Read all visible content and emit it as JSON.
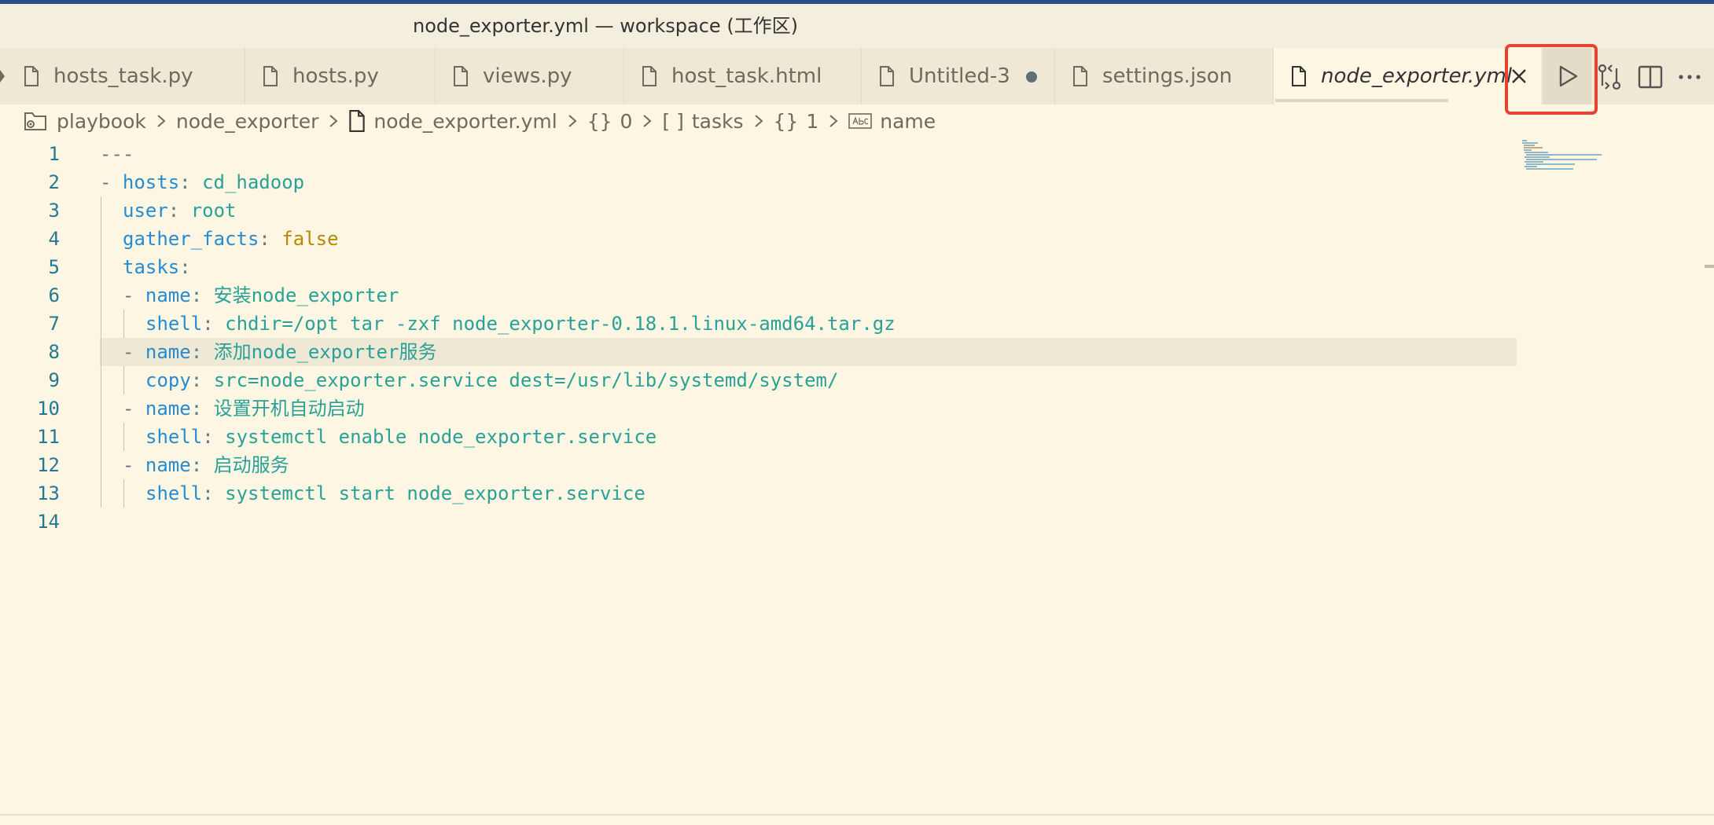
{
  "window": {
    "title": "node_exporter.yml — workspace (工作区)"
  },
  "tabs": [
    {
      "label": "hosts_task.py",
      "dirty": false,
      "active": false
    },
    {
      "label": "hosts.py",
      "dirty": false,
      "active": false
    },
    {
      "label": "views.py",
      "dirty": false,
      "active": false
    },
    {
      "label": "host_task.html",
      "dirty": false,
      "active": false
    },
    {
      "label": "Untitled-3",
      "dirty": true,
      "active": false
    },
    {
      "label": "settings.json",
      "dirty": false,
      "active": false
    },
    {
      "label": "node_exporter.yml",
      "dirty": false,
      "active": true
    }
  ],
  "editor_actions": [
    "run-icon",
    "open-changes-icon",
    "split-editor-icon",
    "more-actions-icon"
  ],
  "breadcrumb": {
    "items": [
      "playbook",
      "node_exporter",
      "node_exporter.yml",
      "0",
      "tasks",
      "1",
      "name"
    ],
    "glyphs": {
      "object": "{}",
      "array": "[ ]"
    }
  },
  "editor": {
    "lines": [
      {
        "n": "1"
      },
      {
        "n": "2"
      },
      {
        "n": "3"
      },
      {
        "n": "4"
      },
      {
        "n": "5"
      },
      {
        "n": "6"
      },
      {
        "n": "7"
      },
      {
        "n": "8"
      },
      {
        "n": "9"
      },
      {
        "n": "10"
      },
      {
        "n": "11"
      },
      {
        "n": "12"
      },
      {
        "n": "13"
      },
      {
        "n": "14"
      }
    ],
    "current_line": "8",
    "code": {
      "l1": "---",
      "dash": "-",
      "colon": ":",
      "hosts_key": "hosts",
      "hosts_val": "cd_hadoop",
      "user_key": "user",
      "user_val": "root",
      "gather_key": "gather_facts",
      "gather_val": "false",
      "tasks_key": "tasks",
      "name_key": "name",
      "shell_key": "shell",
      "copy_key": "copy",
      "t1_name": "安装node_exporter",
      "t1_shell": "chdir=/opt tar -zxf node_exporter-0.18.1.linux-amd64.tar.gz",
      "t2_name": "添加node_exporter服务",
      "t2_copy": "src=node_exporter.service dest=/usr/lib/systemd/system/",
      "t3_name": "设置开机自动启动",
      "t3_shell": "systemctl enable node_exporter.service",
      "t4_name": "启动服务",
      "t4_shell": "systemctl start node_exporter.service"
    }
  },
  "colors": {
    "background": "#FDF6E3",
    "key": "#268BD2",
    "string": "#2AA198",
    "boolean": "#B58900",
    "line_number": "#237893",
    "highlight_box": "#E64432"
  }
}
